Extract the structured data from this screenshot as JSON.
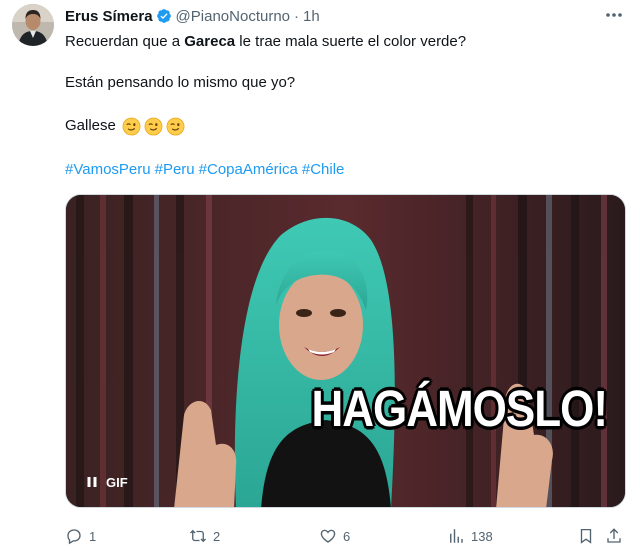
{
  "author": {
    "name": "Erus Símera",
    "handle": "@PianoNocturno",
    "separator": "·",
    "time": "1h",
    "avatar_icon": "avatar-photo",
    "verified_icon": "verified-badge-icon"
  },
  "tweet": {
    "line1_prefix": "Recuerdan que a ",
    "line1_bold": "Gareca",
    "line1_suffix": " le trae mala suerte el color verde?",
    "line2": "Están pensando lo mismo que yo?",
    "line3": "Gallese",
    "emoji_icons": [
      "winking-face-emoji",
      "winking-face-emoji",
      "winking-face-emoji"
    ],
    "hashtags": [
      "#VamosPeru",
      "#Peru",
      "#CopaAmérica",
      "#Chile"
    ]
  },
  "media": {
    "type": "gif",
    "caption": "HAGÁMOSLO!",
    "badge_label": "GIF",
    "pause_icon": "pause-icon"
  },
  "actions": {
    "reply_count": "1",
    "retweet_count": "2",
    "like_count": "6",
    "views_count": "138",
    "icons": [
      "reply-icon",
      "retweet-icon",
      "like-icon",
      "views-icon",
      "bookmark-icon",
      "share-icon"
    ]
  },
  "colors": {
    "link": "#1d9bf0",
    "secondary_text": "#536471",
    "primary_text": "#0f1419",
    "verified": "#1d9bf0"
  }
}
